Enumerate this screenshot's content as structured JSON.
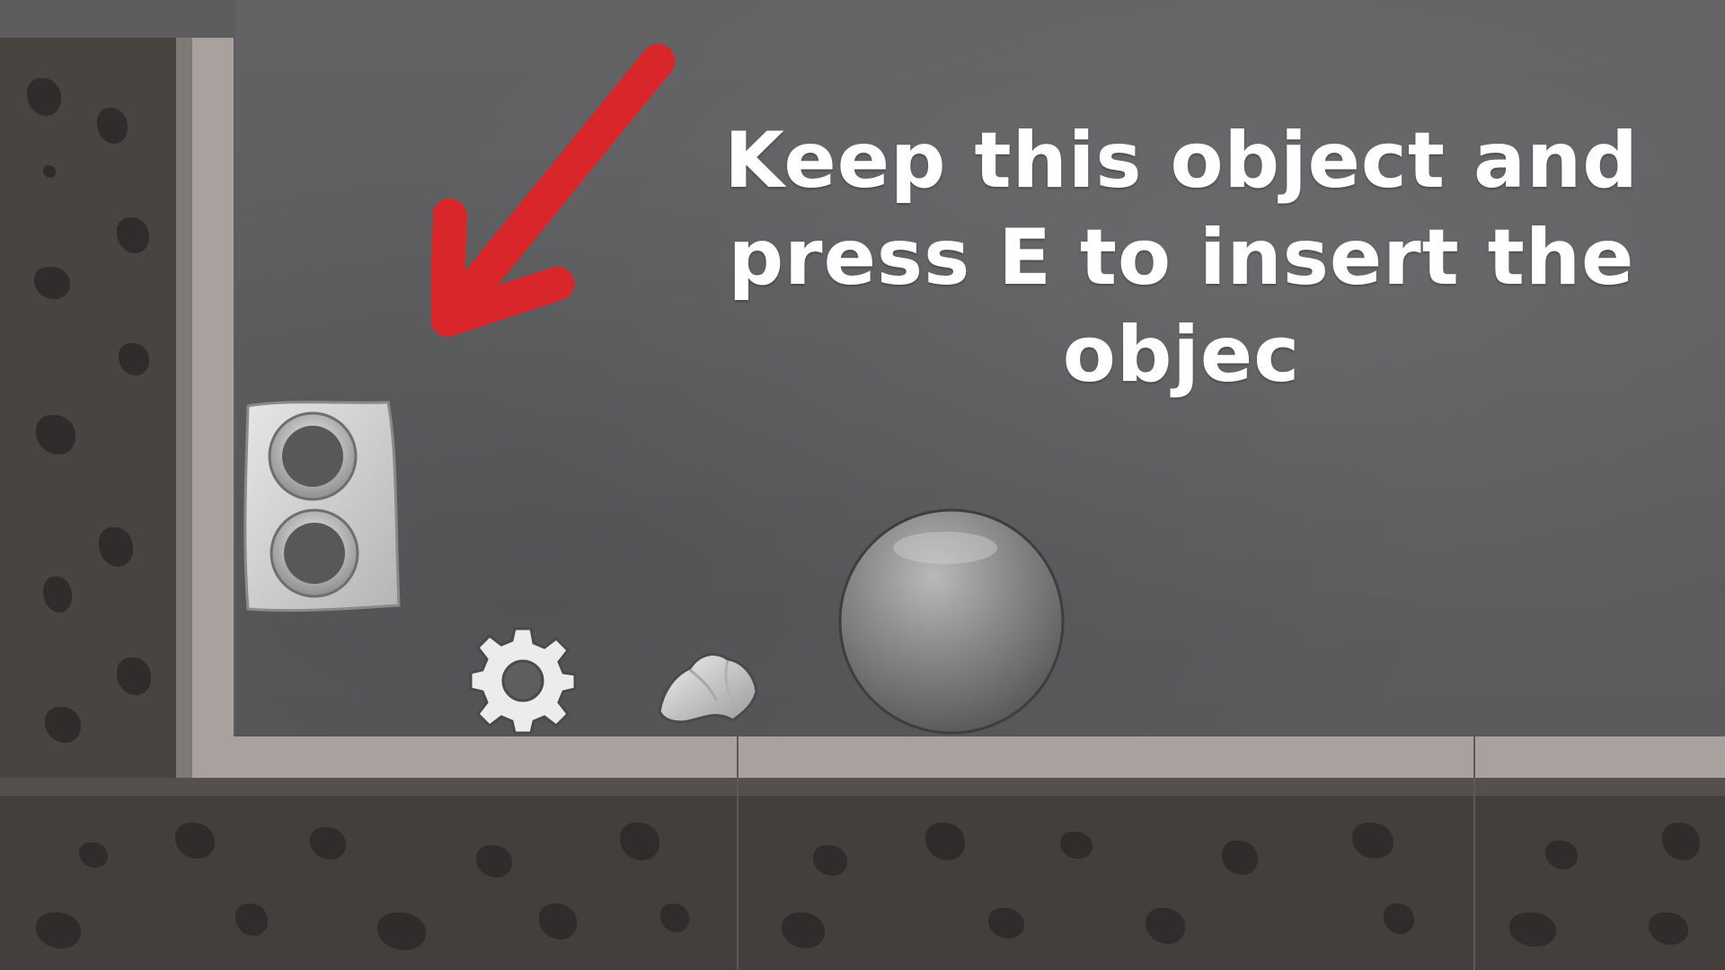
{
  "instruction": {
    "lines": [
      "Keep this object and",
      "press E to insert the",
      "objec"
    ]
  },
  "colors": {
    "arrow": "#d8262a",
    "chalkboard": "#5f5f61",
    "wall_dark": "#474442",
    "wall_light": "#a8a19e",
    "text": "#ffffff"
  },
  "objects": {
    "arrow_icon": "arrow-down-left-icon",
    "socket": "double-socket-receptacle",
    "gear": "gear-icon",
    "rock": "stone-chunk",
    "ball": "metal-ball"
  }
}
